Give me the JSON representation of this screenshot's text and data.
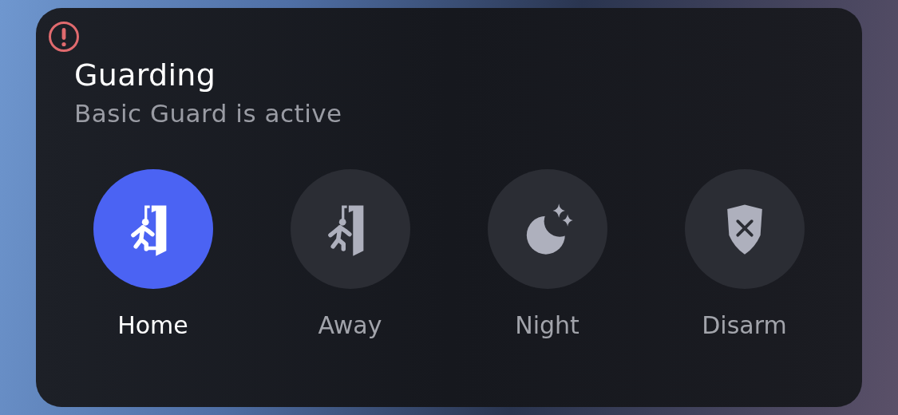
{
  "alert": {
    "shown": true
  },
  "title": "Guarding",
  "subtitle": "Basic Guard is active",
  "modes": [
    {
      "kind": "home",
      "label": "Home",
      "selected": true
    },
    {
      "kind": "away",
      "label": "Away",
      "selected": false
    },
    {
      "kind": "night",
      "label": "Night",
      "selected": false
    },
    {
      "kind": "disarm",
      "label": "Disarm",
      "selected": false
    }
  ]
}
